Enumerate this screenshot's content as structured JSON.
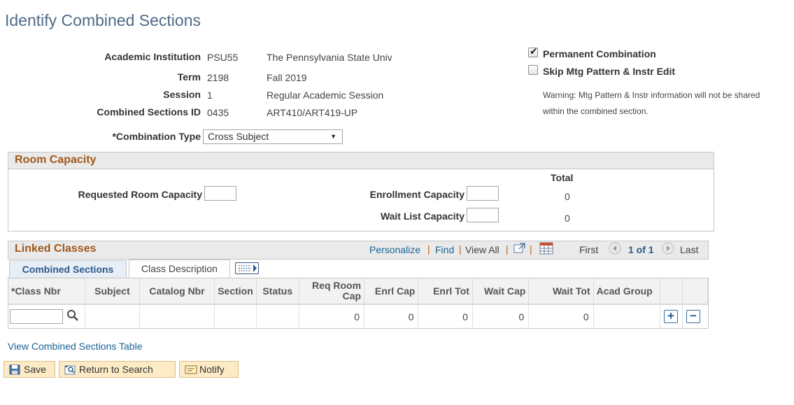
{
  "page": {
    "title": "Identify Combined Sections"
  },
  "header": {
    "institution": {
      "label": "Academic Institution",
      "code": "PSU55",
      "desc": "The Pennsylvania State Univ"
    },
    "term": {
      "label": "Term",
      "code": "2198",
      "desc": "Fall 2019"
    },
    "session": {
      "label": "Session",
      "code": "1",
      "desc": "Regular Academic Session"
    },
    "combined_id": {
      "label": "Combined Sections ID",
      "code": "0435",
      "desc": "ART410/ART419-UP"
    },
    "combination_type": {
      "label": "*Combination Type",
      "value": "Cross Subject"
    }
  },
  "options": {
    "permanent": {
      "label": "Permanent Combination",
      "checked": true
    },
    "skip_mtg": {
      "label": "Skip Mtg Pattern & Instr Edit",
      "checked": false
    },
    "warning_line1": "Warning: Mtg Pattern & Instr information will not be shared",
    "warning_line2": "within the combined section."
  },
  "room_capacity": {
    "title": "Room Capacity",
    "requested_label": "Requested Room Capacity",
    "total_header": "Total",
    "enrollment_label": "Enrollment Capacity",
    "enrollment_total": "0",
    "waitlist_label": "Wait List Capacity",
    "waitlist_total": "0"
  },
  "linked_classes": {
    "title": "Linked Classes",
    "personalize": "Personalize",
    "find": "Find",
    "view_all": "View All",
    "first": "First",
    "page_info": "1 of 1",
    "last": "Last",
    "tabs": [
      "Combined Sections",
      "Class Description"
    ],
    "columns": [
      "*Class Nbr",
      "Subject",
      "Catalog Nbr",
      "Section",
      "Status",
      "Req Room Cap",
      "Enrl Cap",
      "Enrl Tot",
      "Wait Cap",
      "Wait Tot",
      "Acad Group"
    ],
    "row": {
      "class_nbr": "",
      "subject": "",
      "catalog_nbr": "",
      "section": "",
      "status": "",
      "req_room_cap": "0",
      "enrl_cap": "0",
      "enrl_tot": "0",
      "wait_cap": "0",
      "wait_tot": "0",
      "acad_group": ""
    }
  },
  "footer": {
    "view_link": "View Combined Sections Table",
    "save": "Save",
    "return": "Return to Search",
    "notify": "Notify"
  },
  "colors": {
    "title": "#4f6a88",
    "section_header": "#a0581b",
    "link": "#1a6496",
    "button_bg": "#fdebc6"
  }
}
